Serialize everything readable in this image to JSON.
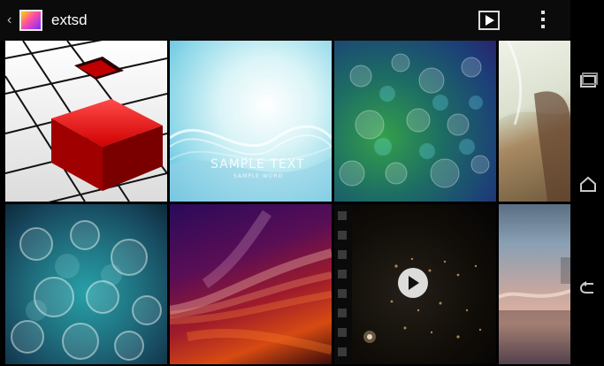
{
  "app": {
    "title": "extsd",
    "icons": {
      "back": "chevron-left-icon",
      "app": "gallery-app-icon",
      "slideshow": "play-slideshow-icon",
      "overflow": "overflow-menu-icon"
    }
  },
  "colors": {
    "actionbar_bg": "#0b0b0b",
    "text": "#ffffff",
    "nav_bg": "#000000"
  },
  "grid": {
    "items": [
      {
        "kind": "image",
        "description_icon": "image-thumbnail"
      },
      {
        "kind": "image",
        "description_icon": "image-thumbnail",
        "overlay_text_main": "SAMPLE TEXT",
        "overlay_text_sub": "SAMPLE WORD"
      },
      {
        "kind": "image",
        "description_icon": "image-thumbnail"
      },
      {
        "kind": "image",
        "description_icon": "image-thumbnail"
      },
      {
        "kind": "image",
        "description_icon": "image-thumbnail"
      },
      {
        "kind": "image",
        "description_icon": "image-thumbnail"
      },
      {
        "kind": "video",
        "description_icon": "video-thumbnail",
        "overlay_icon": "play-circle-icon"
      },
      {
        "kind": "image",
        "description_icon": "image-thumbnail"
      }
    ]
  },
  "navbar": {
    "recent_icon": "recent-apps-icon",
    "home_icon": "home-icon",
    "back_icon": "back-icon"
  }
}
